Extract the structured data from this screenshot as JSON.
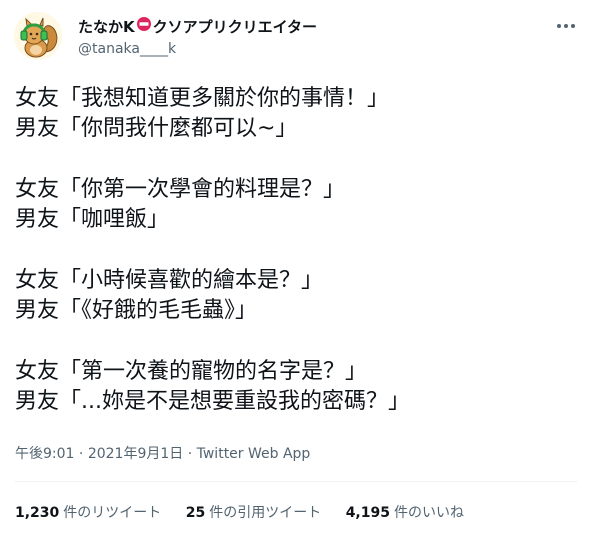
{
  "author": {
    "display_name_before": "たなかK",
    "display_name_after": "クソアプリクリエイター",
    "name_emoji_icon": "no-entry-sign-icon",
    "handle": "@tanaka____k",
    "avatar_icon": "squirrel-headphones-avatar-icon"
  },
  "tweet_lines": [
    "女友「我想知道更多關於你的事情！」",
    "男友「你問我什麼都可以~」",
    "",
    "女友「你第一次學會的料理是？」",
    "男友「咖哩飯」",
    "",
    "女友「小時候喜歡的繪本是？」",
    "男友「《好餓的毛毛蟲》」",
    "",
    "女友「第一次養的寵物的名字是？」",
    "男友「...妳是不是想要重設我的密碼？」"
  ],
  "meta": {
    "time": "午後9:01",
    "separator": " · ",
    "date": "2021年9月1日",
    "source": "Twitter Web App"
  },
  "stats": {
    "retweets_count": "1,230",
    "retweets_label": "件のリツイート",
    "quotes_count": "25",
    "quotes_label": "件の引用ツイート",
    "likes_count": "4,195",
    "likes_label": "件のいいね"
  },
  "colors": {
    "text": "#0f1419",
    "secondary": "#536471",
    "divider": "#eff3f4",
    "emoji_red": "#e0245e"
  }
}
